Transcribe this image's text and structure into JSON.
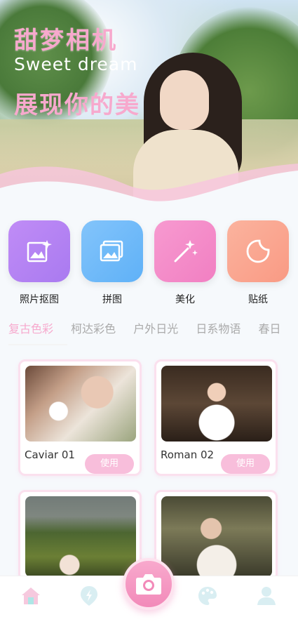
{
  "hero": {
    "title": "甜梦相机",
    "subtitle": "Sweet dream",
    "slogan": "展现你的美"
  },
  "features": [
    {
      "label": "照片抠图",
      "icon": "photo-edit-icon",
      "color_from": "#c08cf6",
      "color_to": "#a97af0"
    },
    {
      "label": "拼图",
      "icon": "collage-icon",
      "color_from": "#83c4fb",
      "color_to": "#5fb1f7"
    },
    {
      "label": "美化",
      "icon": "magic-wand-icon",
      "color_from": "#f79ad0",
      "color_to": "#f17fc2"
    },
    {
      "label": "贴纸",
      "icon": "sticker-icon",
      "color_from": "#fbb39e",
      "color_to": "#f99a84"
    }
  ],
  "tabs": [
    "复古色彩",
    "柯达彩色",
    "户外日光",
    "日系物语",
    "春日"
  ],
  "active_tab": "复古色彩",
  "filters": [
    {
      "name": "Caviar 01",
      "button": "使用"
    },
    {
      "name": "Roman 02",
      "button": "使用"
    },
    {
      "name": "",
      "button": ""
    },
    {
      "name": "",
      "button": ""
    }
  ],
  "bottom_nav": [
    "home-icon",
    "explore-icon",
    "camera-icon",
    "palette-icon",
    "profile-icon"
  ],
  "colors": {
    "accent": "#f7a9cd",
    "button": "#f8bedb"
  }
}
